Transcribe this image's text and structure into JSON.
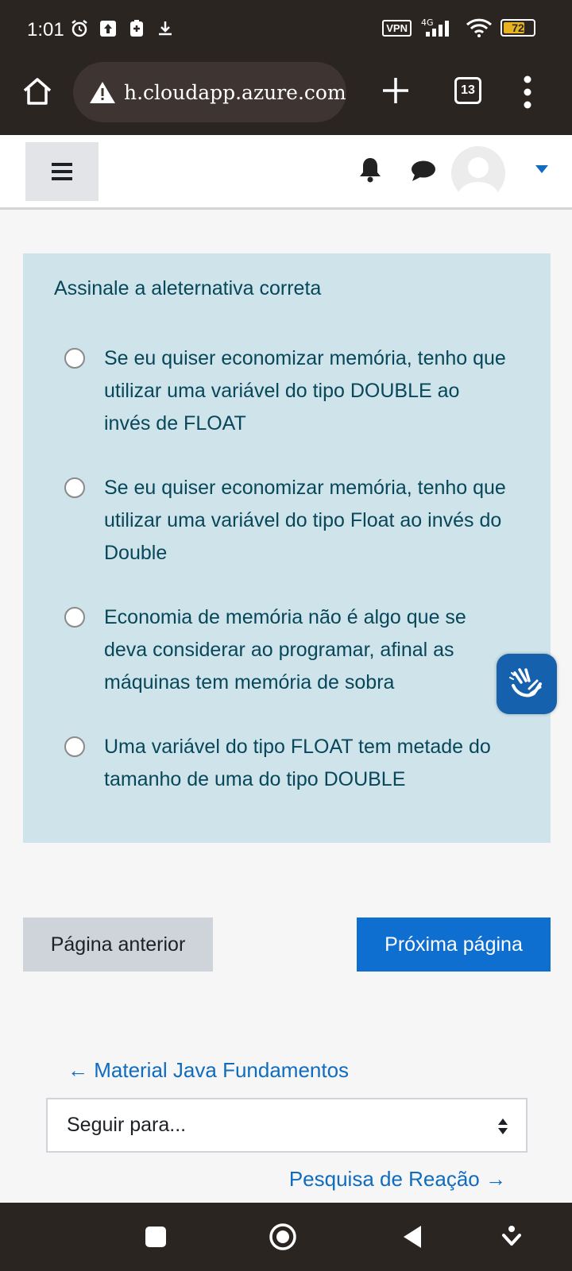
{
  "status_bar": {
    "time": "1:01",
    "vpn": "VPN",
    "network": "4G",
    "battery": 72
  },
  "browser": {
    "url": "h.cloudapp.azure.com",
    "tab_count": "13"
  },
  "question": {
    "text": "Assinale a aleternativa correta",
    "options": [
      "Se eu quiser economizar memória, tenho que utilizar uma variável do tipo DOUBLE ao invés de FLOAT",
      "Se eu quiser economizar memória, tenho que utilizar uma variável do tipo Float ao invés do Double",
      "Economia de memória não é algo que se deva considerar ao programar, afinal as máquinas tem memória de sobra",
      "Uma variável do tipo FLOAT tem metade do tamanho de uma do tipo DOUBLE"
    ]
  },
  "buttons": {
    "prev": "Página anterior",
    "next": "Próxima página"
  },
  "navigation": {
    "prev_link": "← Material Java Fundamentos",
    "jump_to": "Seguir para...",
    "next_link": "Pesquisa de Reação →"
  },
  "colors": {
    "question_bg": "#cee4ea",
    "primary": "#0f6fd0",
    "link": "#0f6cbf",
    "dark_bar": "#2b2522"
  },
  "icons": [
    "alarm-icon",
    "upload-icon",
    "battery-saver-icon",
    "download-icon",
    "signal-icon",
    "wifi-icon",
    "home-icon",
    "warning-icon",
    "plus-icon",
    "more-icon",
    "hamburger-icon",
    "bell-icon",
    "chat-icon",
    "avatar-icon",
    "caret-down-icon",
    "sign-language-icon",
    "square-icon",
    "circle-icon",
    "back-icon",
    "keyboard-down-icon"
  ]
}
